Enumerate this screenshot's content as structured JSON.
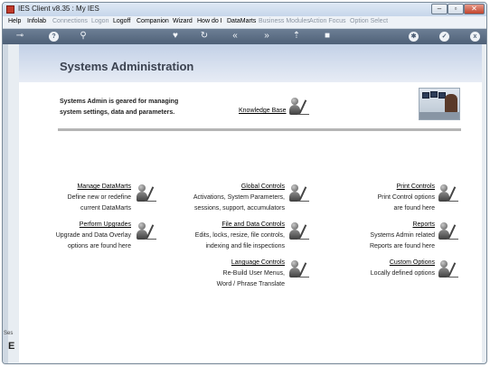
{
  "window": {
    "title": "IES Client v8.35 : My IES",
    "controls": {
      "minimize": "–",
      "maximize": "▫",
      "close": "✕"
    }
  },
  "menu": {
    "items": [
      {
        "label": "Help",
        "enabled": true
      },
      {
        "label": "Infolab",
        "enabled": true
      },
      {
        "label": "Connections",
        "enabled": false
      },
      {
        "label": "Logon",
        "enabled": false
      },
      {
        "label": "Logoff",
        "enabled": true
      },
      {
        "label": "Companion",
        "enabled": true
      },
      {
        "label": "Wizard",
        "enabled": true
      },
      {
        "label": "How do I",
        "enabled": true
      },
      {
        "label": "DataMarts",
        "enabled": true
      },
      {
        "label": "Business Modules",
        "enabled": false
      },
      {
        "label": "Action Focus",
        "enabled": false
      },
      {
        "label": "Option Select",
        "enabled": false
      }
    ]
  },
  "toolbar": {
    "icons": [
      "key-icon",
      "help-icon",
      "search-icon",
      "heart-icon",
      "refresh-icon",
      "rewind-icon",
      "fast-forward-icon",
      "upload-icon",
      "stop-icon",
      "settings-icon",
      "ok-icon",
      "close-icon"
    ],
    "glyphs": {
      "key": "⊸",
      "help": "?",
      "search": "⚲",
      "heart": "♥",
      "refresh": "↻",
      "rewind": "«",
      "forward": "»",
      "upload": "⇡",
      "stop": "■",
      "settings": "✱",
      "ok": "✓",
      "close": "x"
    }
  },
  "sidebar": {
    "hint": "Ses",
    "letter": "E"
  },
  "page": {
    "title": "Systems Administration",
    "intro_line1": "Systems Admin is geared for managing",
    "intro_line2": "system settings, data and parameters.",
    "knowledge_base": "Knowledge Base"
  },
  "sections": {
    "manage_datamarts": {
      "title": "Manage DataMarts",
      "line1": "Define new or redefine",
      "line2": "current DataMarts"
    },
    "global_controls": {
      "title": "Global Controls",
      "line1": "Activations, System Parameters,",
      "line2": "sessions, support, accumulators"
    },
    "print_controls": {
      "title": "Print Controls",
      "line1": "Print Control options",
      "line2": "are found here"
    },
    "perform_upgrades": {
      "title": "Perform Upgrades",
      "line1": "Upgrade and Data Overlay",
      "line2": "options are found here"
    },
    "file_data_controls": {
      "title": "File and Data Controls",
      "line1": "Edits, locks, resize, file controls,",
      "line2": "indexing and file inspections"
    },
    "reports": {
      "title": "Reports",
      "line1": "Systems Admin related",
      "line2": "Reports are found here"
    },
    "language_controls": {
      "title": "Language Controls",
      "line1": "Re-Build User Menus,",
      "line2": "Word / Phrase Translate"
    },
    "custom_options": {
      "title": "Custom Options",
      "line1": "Locally defined options"
    }
  }
}
